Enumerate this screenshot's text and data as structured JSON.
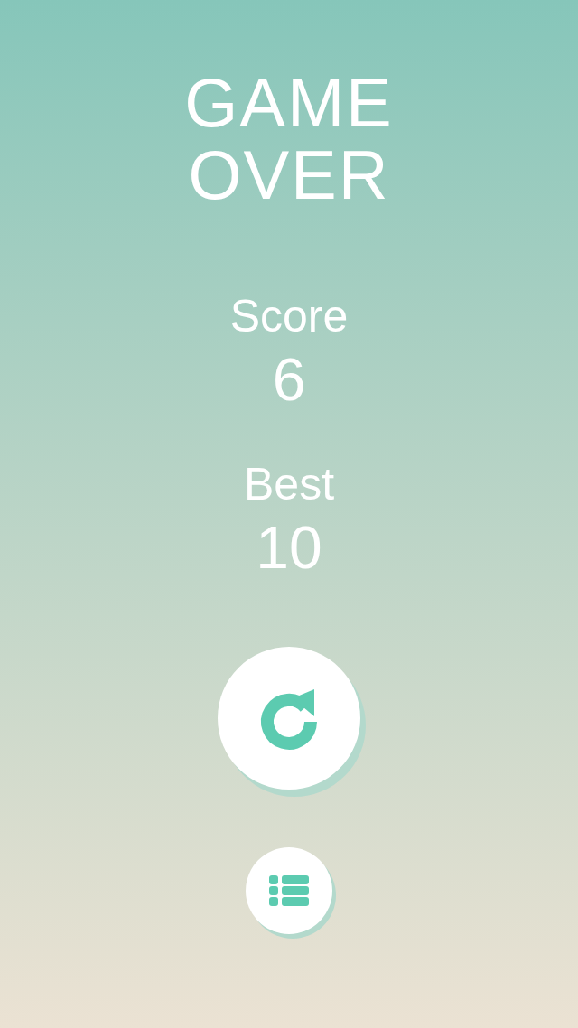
{
  "title": "GAME OVER",
  "stats": [
    {
      "label": "Score",
      "value": "6"
    },
    {
      "label": "Best",
      "value": "10"
    }
  ],
  "buttons": [
    {
      "kind": "restart"
    },
    {
      "kind": "list"
    }
  ]
}
